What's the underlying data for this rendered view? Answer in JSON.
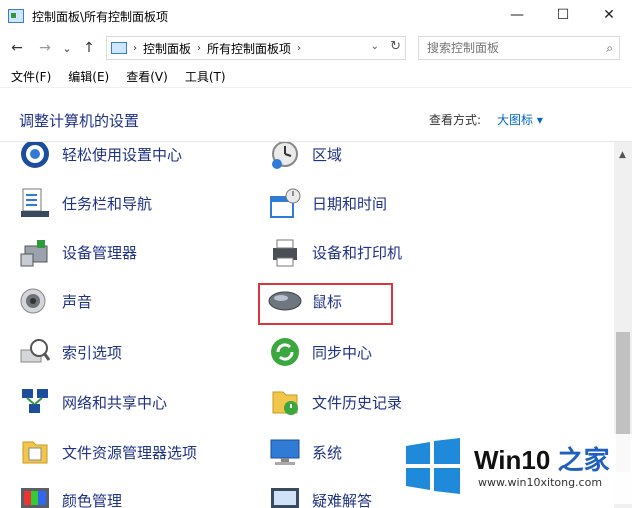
{
  "window": {
    "title": "控制面板\\所有控制面板项",
    "minimize_glyph": "—",
    "maximize_glyph": "☐",
    "close_glyph": "✕"
  },
  "nav": {
    "back_glyph": "←",
    "forward_glyph": "→",
    "recent_glyph": "⌄",
    "up_glyph": "↑"
  },
  "address": {
    "crumbs": [
      "控制面板",
      "所有控制面板项"
    ],
    "separator": "›",
    "dropdown_glyph": "⌄",
    "refresh_glyph": "↻"
  },
  "search": {
    "placeholder": "搜索控制面板",
    "icon_glyph": "⌕"
  },
  "menubar": [
    "文件(F)",
    "编辑(E)",
    "查看(V)",
    "工具(T)"
  ],
  "header": {
    "heading": "调整计算机的设置",
    "view_label": "查看方式:",
    "view_value": "大图标 ▾"
  },
  "items": [
    {
      "label": "轻松使用设置中心",
      "icon": "ease-of-access-icon"
    },
    {
      "label": "区域",
      "icon": "region-clock-icon"
    },
    {
      "label": "任务栏和导航",
      "icon": "taskbar-icon"
    },
    {
      "label": "日期和时间",
      "icon": "date-time-icon"
    },
    {
      "label": "设备管理器",
      "icon": "device-manager-icon"
    },
    {
      "label": "设备和打印机",
      "icon": "printer-icon"
    },
    {
      "label": "声音",
      "icon": "speaker-icon"
    },
    {
      "label": "鼠标",
      "icon": "mouse-icon"
    },
    {
      "label": "索引选项",
      "icon": "indexing-icon"
    },
    {
      "label": "同步中心",
      "icon": "sync-icon"
    },
    {
      "label": "网络和共享中心",
      "icon": "network-icon"
    },
    {
      "label": "文件历史记录",
      "icon": "file-history-icon"
    },
    {
      "label": "文件资源管理器选项",
      "icon": "folder-options-icon"
    },
    {
      "label": "系统",
      "icon": "system-icon"
    },
    {
      "label": "颜色管理",
      "icon": "color-management-icon"
    },
    {
      "label": "疑难解答",
      "icon": "troubleshooting-icon"
    }
  ],
  "scroll": {
    "up_glyph": "▲"
  },
  "watermark": {
    "brand_main": "Win10 ",
    "brand_accent": "之家",
    "site": "www.win10xitong.com"
  },
  "colors": {
    "link_blue": "#1e3287",
    "highlight_red": "#d9363e",
    "win_blue": "#1e8ad9"
  }
}
